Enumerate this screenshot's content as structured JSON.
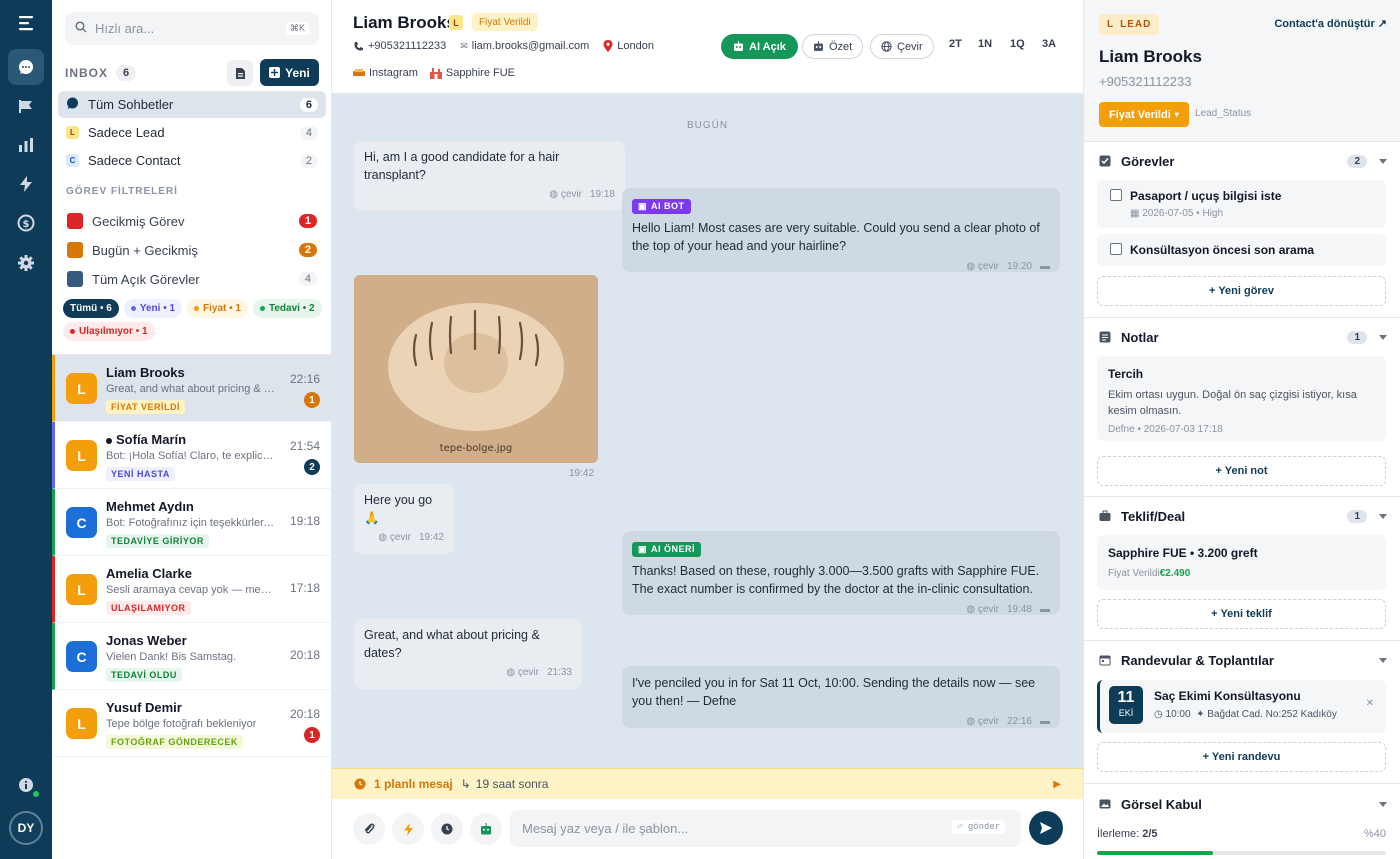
{
  "rail": {
    "user_initials": "DY"
  },
  "inbox": {
    "search_placeholder": "Hızlı ara...",
    "search_shortcut": "⌘K",
    "title": "INBOX",
    "count": "6",
    "new_label": "Yeni",
    "filters": [
      {
        "label": "Tüm Sohbetler",
        "count": "6"
      },
      {
        "label": "Sadece Lead",
        "count": "4",
        "badge": "L"
      },
      {
        "label": "Sadece Contact",
        "count": "2",
        "badge": "C"
      }
    ],
    "task_section_title": "GÖREV FİLTRELERİ",
    "task_filters": [
      {
        "label": "Gecikmiş Görev",
        "count": "1",
        "color": "#dc2626"
      },
      {
        "label": "Bugün + Gecikmiş",
        "count": "2",
        "color": "#d97706"
      },
      {
        "label": "Tüm Açık Görevler",
        "count": "4",
        "color": "#375a7f"
      }
    ],
    "chips": [
      {
        "label": "Tümü • 6"
      },
      {
        "label": "Yeni • 1",
        "color": "#6366f1"
      },
      {
        "label": "Fiyat • 1",
        "color": "#f59e0b"
      },
      {
        "label": "Tedavi • 2",
        "color": "#16a34a"
      },
      {
        "label": "Ulaşılmıyor • 1",
        "color": "#dc2626"
      }
    ],
    "conversations": [
      {
        "initial": "L",
        "name": "Liam Brooks",
        "preview": "Great, and what about pricing & dates?",
        "tag": "FİYAT VERİLDİ",
        "time": "22:16",
        "unread": "1"
      },
      {
        "initial": "L",
        "name": "Sofía Marín",
        "preview": "Bot: ¡Hola Sofía! Claro, te explico cómo funciona",
        "tag": "YENİ HASTA",
        "time": "21:54",
        "unread": "2"
      },
      {
        "initial": "C",
        "name": "Mehmet Aydın",
        "preview": "Bot: Fotoğrafınız için teşekkürler, inceliyoruz",
        "tag": "TEDAVİYE GİRİYOR",
        "time": "19:18",
        "unread": ""
      },
      {
        "initial": "L",
        "name": "Amelia Clarke",
        "preview": "Sesli aramaya cevap yok — mesaj bırakıldı",
        "tag": "ULAŞILAMIYOR",
        "time": "17:18",
        "unread": ""
      },
      {
        "initial": "C",
        "name": "Jonas Weber",
        "preview": "Vielen Dank! Bis Samstag.",
        "tag": "TEDAVİ OLDU",
        "time": "20:18",
        "unread": ""
      },
      {
        "initial": "L",
        "name": "Yusuf Demir",
        "preview": "Tepe bölge fotoğrafı bekleniyor",
        "tag": "FOTOĞRAF GÖNDERECEK",
        "time": "20:18",
        "unread": "1"
      }
    ]
  },
  "chat": {
    "name": "Liam Brooks",
    "type_badge": "L",
    "status": "Fiyat Verildi",
    "phone": "+905321112233",
    "email": "liam.brooks@gmail.com",
    "location": "London",
    "source": "Instagram",
    "interest": "Sapphire FUE",
    "ai_button": "AI Açık",
    "summary_button": "Özet",
    "translate_button": "Çevir",
    "ranges": [
      "2T",
      "1N",
      "1Q",
      "3A"
    ],
    "day_label": "BUGÜN",
    "translate_label": "çevir",
    "messages": {
      "m1": {
        "text": "Hi, am I a good candidate for a hair transplant?",
        "time": "19:18"
      },
      "m2": {
        "tag": "AI BOT",
        "text": "Hello Liam! Most cases are very suitable. Could you send a clear photo of the top of your head and your hairline?",
        "time": "19:20"
      },
      "m3": {
        "filename": "tepe-bolge.jpg",
        "time": "19:42"
      },
      "m4": {
        "text": "Here you go 🙏",
        "time": "19:42"
      },
      "m5": {
        "tag": "AI ÖNERİ",
        "text": "Thanks! Based on these, roughly 3.000—3.500 grafts with Sapphire FUE. The exact number is confirmed by the doctor at the in-clinic consultation.",
        "time": "19:48"
      },
      "m6": {
        "text": "Great, and what about pricing & dates?",
        "time": "21:33"
      },
      "m7": {
        "text": "I've penciled you in for Sat 11 Oct, 10:00. Sending the details now — see you then! — Defne",
        "time": "22:16"
      }
    },
    "scheduled": {
      "label": "1 planlı mesaj",
      "when": "19 saat sonra"
    },
    "compose_placeholder": "Mesaj yaz veya / ile şablon...",
    "send_hint": "⏎ gönder"
  },
  "side": {
    "tag": "LEAD",
    "tag_letter": "L",
    "convert_label": "Contact'a dönüştür ↗",
    "name": "Liam Brooks",
    "phone": "+905321112233",
    "status_button": "Fiyat Verildi",
    "status_field": "Lead_Status",
    "tasks": {
      "title": "Görevler",
      "count": "2",
      "items": [
        {
          "title": "Pasaport / uçuş bilgisi iste",
          "meta": "2026-07-05 • High"
        },
        {
          "title": "Konsültasyon öncesi son arama"
        }
      ],
      "add": "+ Yeni görev"
    },
    "notes": {
      "title": "Notlar",
      "count": "1",
      "item": {
        "title": "Tercih",
        "body": "Ekim ortası uygun. Doğal ön saç çizgisi istiyor, kısa kesim olmasın.",
        "meta": "Defne • 2026-07-03 17:18"
      },
      "add": "+ Yeni not"
    },
    "deals": {
      "title": "Teklif/Deal",
      "count": "1",
      "item": {
        "title": "Sapphire FUE • 3.200 greft",
        "stage": "Fiyat Verildi",
        "price": "€2.490"
      },
      "add": "+ Yeni teklif"
    },
    "appointments": {
      "title": "Randevular & Toplantılar",
      "item": {
        "day": "11",
        "month": "EKİ",
        "title": "Saç Ekimi Konsültasyonu",
        "time": "10:00",
        "place": "Bağdat Cad. No:252 Kadıköy"
      },
      "add": "+ Yeni randevu"
    },
    "photos": {
      "title": "Görsel Kabul",
      "progress_label": "İlerleme:",
      "progress_value": "2/5",
      "percent": "%40",
      "fraction": 0.4
    }
  }
}
